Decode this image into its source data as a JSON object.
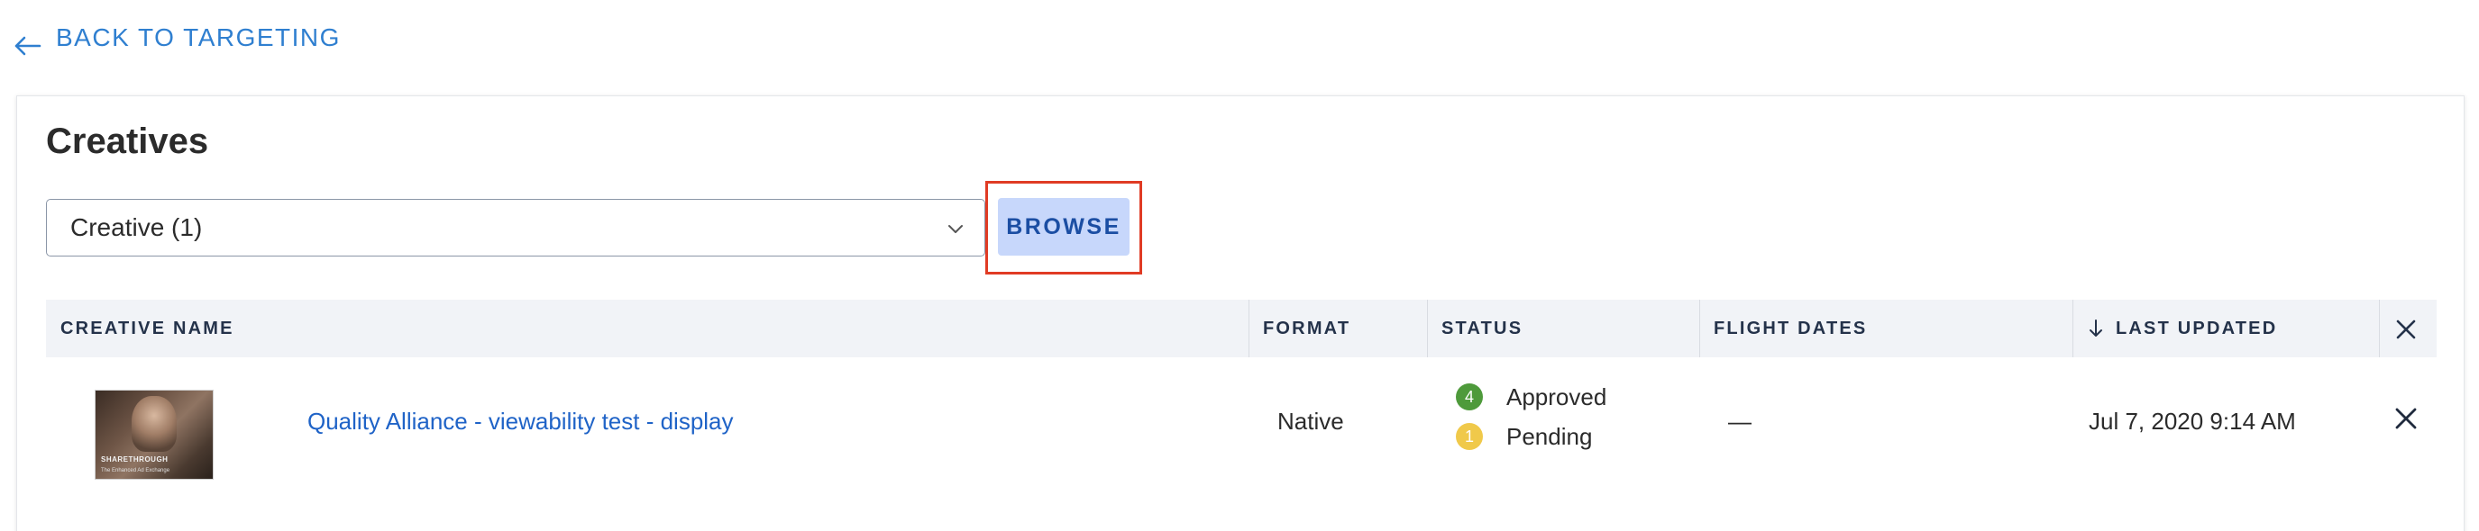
{
  "back_link": {
    "label": "BACK TO TARGETING",
    "icon": "arrow-left-icon"
  },
  "card": {
    "title": "Creatives",
    "select": {
      "value": "Creative (1)",
      "icon": "chevron-down-icon"
    },
    "browse_label": "BROWSE"
  },
  "table": {
    "columns": {
      "creative_name": "CREATIVE NAME",
      "format": "FORMAT",
      "status": "STATUS",
      "flight_dates": "FLIGHT DATES",
      "last_updated": "LAST UPDATED"
    },
    "rows": [
      {
        "thumbnail_brand": "SHARETHROUGH",
        "thumbnail_tagline": "The Enhanced Ad Exchange",
        "name": "Quality Alliance - viewability test - display",
        "format": "Native",
        "statuses": [
          {
            "count": "4",
            "label": "Approved",
            "color": "#4e9a3b"
          },
          {
            "count": "1",
            "label": "Pending",
            "color": "#f0c94a"
          }
        ],
        "flight_dates": "—",
        "last_updated": "Jul 7, 2020 9:14 AM"
      }
    ]
  },
  "colors": {
    "link": "#2f7fd0",
    "browse_bg": "#c7d7fb",
    "highlight": "#e03b24"
  }
}
